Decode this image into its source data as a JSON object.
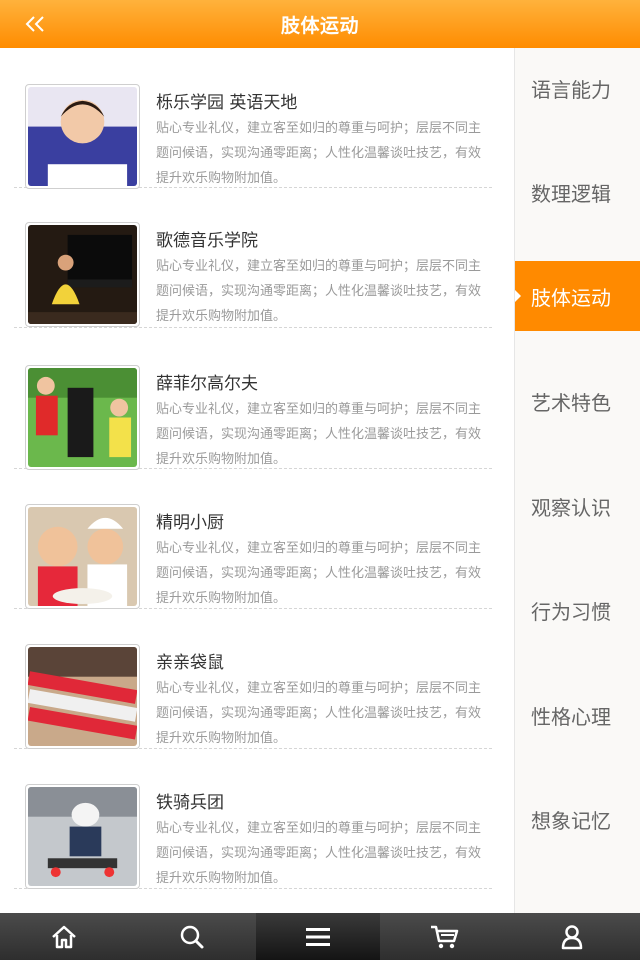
{
  "header": {
    "title": "肢体运动",
    "back_icon": "double-chevron-left-icon"
  },
  "list": [
    {
      "title": "栎乐学园 英语天地",
      "desc": "贴心专业礼仪，建立客至如归的尊重与呵护；层层不同主题问候语，实现沟通零距离；人性化温馨谈吐技艺，有效提升欢乐购物附加值。"
    },
    {
      "title": "歌德音乐学院",
      "desc": "贴心专业礼仪，建立客至如归的尊重与呵护；层层不同主题问候语，实现沟通零距离；人性化温馨谈吐技艺，有效提升欢乐购物附加值。"
    },
    {
      "title": "薛菲尔高尔夫",
      "desc": "贴心专业礼仪，建立客至如归的尊重与呵护；层层不同主题问候语，实现沟通零距离；人性化温馨谈吐技艺，有效提升欢乐购物附加值。"
    },
    {
      "title": "精明小厨",
      "desc": "贴心专业礼仪，建立客至如归的尊重与呵护；层层不同主题问候语，实现沟通零距离；人性化温馨谈吐技艺，有效提升欢乐购物附加值。"
    },
    {
      "title": "亲亲袋鼠",
      "desc": "贴心专业礼仪，建立客至如归的尊重与呵护；层层不同主题问候语，实现沟通零距离；人性化温馨谈吐技艺，有效提升欢乐购物附加值。"
    },
    {
      "title": "铁骑兵团",
      "desc": "贴心专业礼仪，建立客至如归的尊重与呵护；层层不同主题问候语，实现沟通零距离；人性化温馨谈吐技艺，有效提升欢乐购物附加值。"
    }
  ],
  "sidebar": {
    "items": [
      {
        "label": "语言能力",
        "active": false
      },
      {
        "label": "数理逻辑",
        "active": false
      },
      {
        "label": "肢体运动",
        "active": true
      },
      {
        "label": "艺术特色",
        "active": false
      },
      {
        "label": "观察认识",
        "active": false
      },
      {
        "label": "行为习惯",
        "active": false
      },
      {
        "label": "性格心理",
        "active": false
      },
      {
        "label": "想象记忆",
        "active": false
      }
    ]
  },
  "bottom_nav": {
    "items": [
      {
        "icon": "home-icon"
      },
      {
        "icon": "search-icon"
      },
      {
        "icon": "menu-icon",
        "active": true
      },
      {
        "icon": "cart-icon"
      },
      {
        "icon": "user-icon"
      }
    ]
  },
  "colors": {
    "accent": "#ff8a00",
    "header_top": "#ffb23c",
    "text_muted": "#9a9a9a"
  }
}
